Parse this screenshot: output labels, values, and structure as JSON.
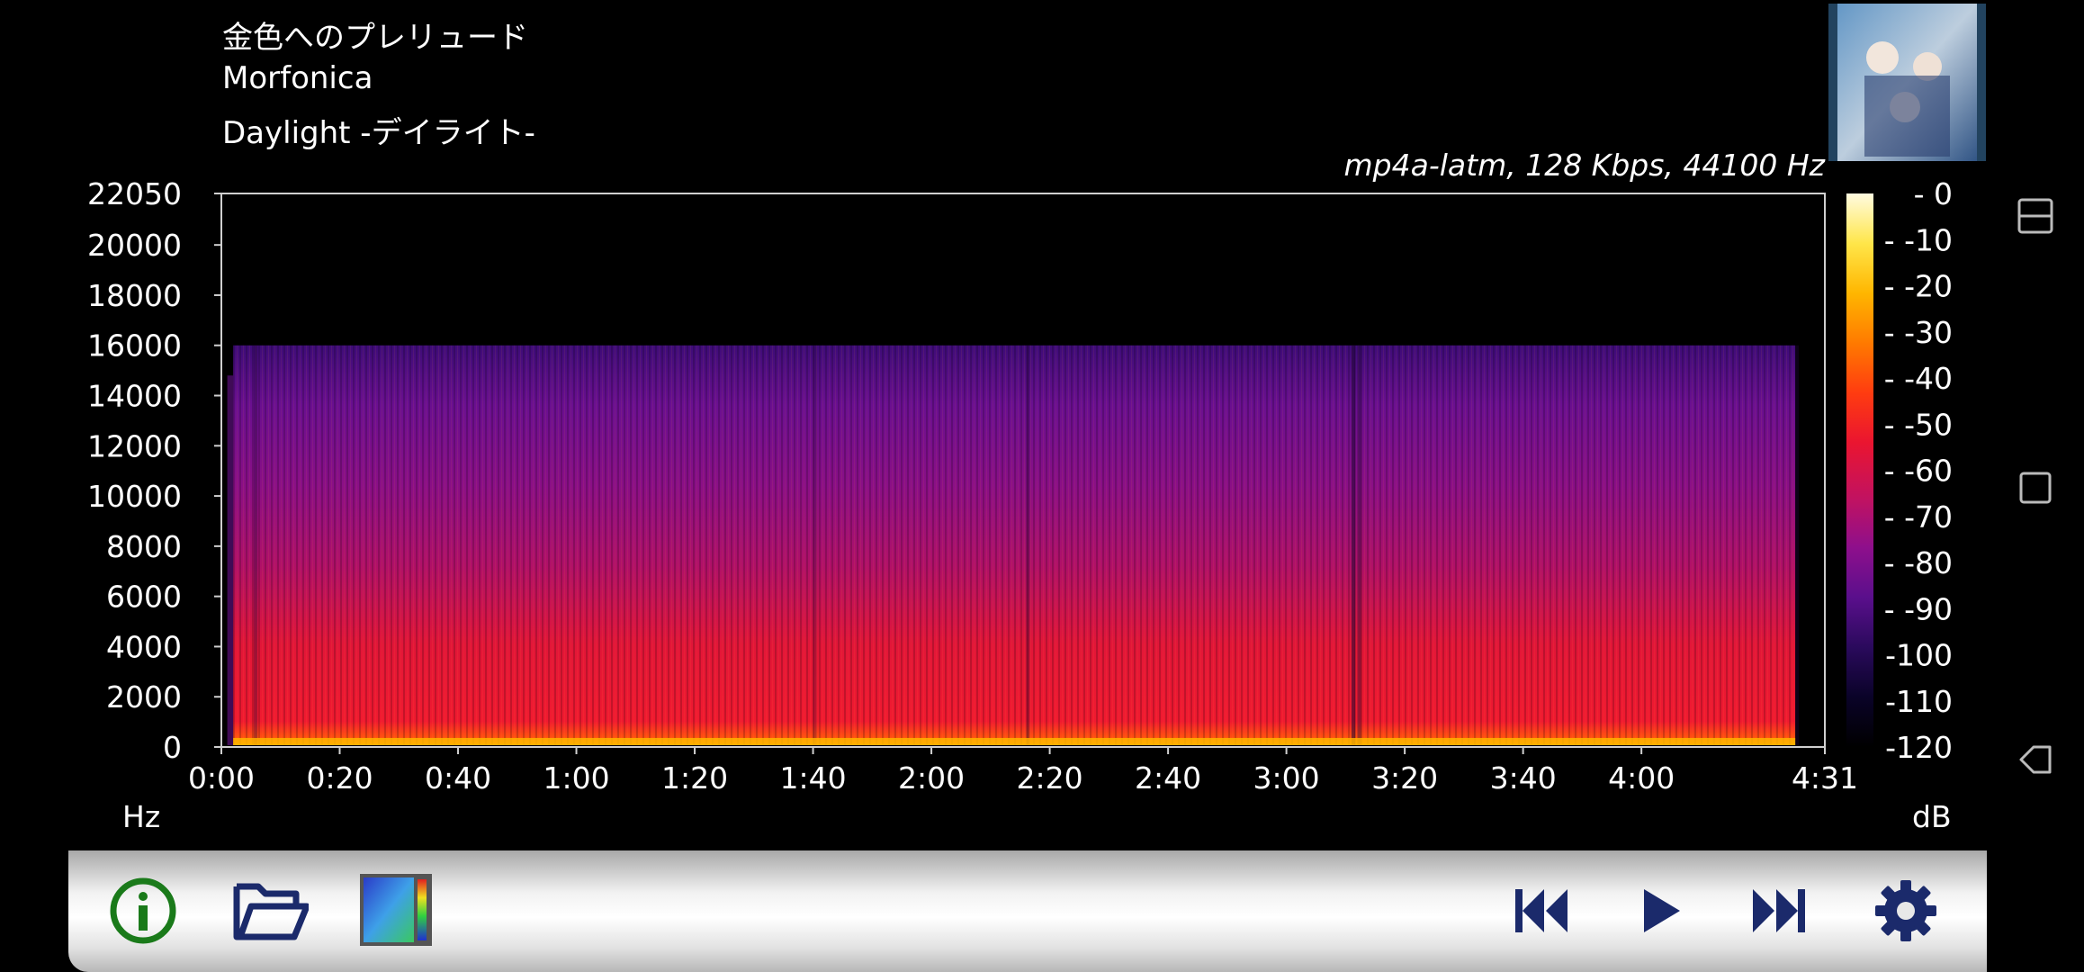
{
  "track": {
    "title": "金色へのプレリュード",
    "artist": "Morfonica",
    "album": "Daylight -デイライト-",
    "codec": "mp4a-latm, 128 Kbps, 44100 Hz"
  },
  "chart_data": {
    "type": "heatmap",
    "title": "",
    "xlabel": "",
    "ylabel": "Hz",
    "y_ticks": [
      "22050",
      "20000",
      "18000",
      "16000",
      "14000",
      "12000",
      "10000",
      "8000",
      "6000",
      "4000",
      "2000",
      "0"
    ],
    "x_ticks": [
      "0:00",
      "0:20",
      "0:40",
      "1:00",
      "1:20",
      "1:40",
      "2:00",
      "2:20",
      "2:40",
      "3:00",
      "3:20",
      "3:40",
      "4:00",
      "4:31"
    ],
    "ylim": [
      0,
      22050
    ],
    "xlim_seconds": [
      0,
      271
    ],
    "colorbar": {
      "label": "dB",
      "ticks": [
        "0",
        "10",
        "20",
        "30",
        "40",
        "50",
        "60",
        "70",
        "80",
        "90",
        "100",
        "110",
        "120"
      ],
      "range": [
        -120,
        0
      ],
      "colors": [
        "#000000",
        "#0a0328",
        "#2a0a5c",
        "#5a0f8c",
        "#8e0f8c",
        "#c21260",
        "#ea1530",
        "#ff3c10",
        "#ff7a00",
        "#ffb600",
        "#ffe64a",
        "#fffbe0"
      ]
    },
    "content": {
      "cutoff_hz": 16000,
      "audio_start_s": 1,
      "audio_end_s": 266,
      "description_levels": {
        "low_band_db": -45,
        "mid_band_db": -70,
        "high_band_db": -85
      }
    }
  },
  "toolbar": {
    "buttons": [
      "info-icon",
      "open-folder-icon",
      "palette-icon",
      "skip-previous-icon",
      "play-icon",
      "skip-next-icon",
      "settings-icon"
    ]
  },
  "colors": {
    "info": "#1a7a1a",
    "toolbar_icon": "#1b2a6b"
  }
}
